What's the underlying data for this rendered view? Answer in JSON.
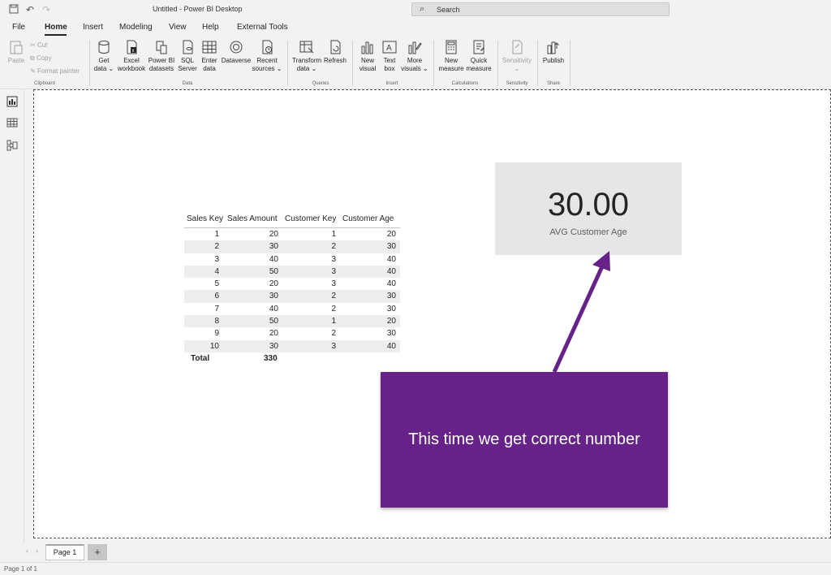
{
  "window": {
    "title": "Untitled - Power BI Desktop"
  },
  "search": {
    "label": "Search"
  },
  "menu": {
    "tabs": [
      "File",
      "Home",
      "Insert",
      "Modeling",
      "View",
      "Help",
      "External Tools"
    ],
    "active": "Home"
  },
  "ribbon": {
    "clipboard": {
      "paste": "Paste",
      "cut": "Cut",
      "copy": "Copy",
      "format_painter": "Format painter",
      "group": "Clipboard"
    },
    "data": {
      "get_data": [
        "Get",
        "data ⌄"
      ],
      "excel": [
        "Excel",
        "workbook"
      ],
      "powerbi": [
        "Power BI",
        "datasets"
      ],
      "sql": [
        "SQL",
        "Server"
      ],
      "enter": [
        "Enter",
        "data"
      ],
      "dataverse": [
        "Dataverse",
        ""
      ],
      "recent": [
        "Recent",
        "sources ⌄"
      ],
      "group": "Data"
    },
    "queries": {
      "transform": [
        "Transform",
        "data ⌄"
      ],
      "refresh": [
        "Refresh",
        ""
      ],
      "group": "Queries"
    },
    "insert": {
      "new_visual": [
        "New",
        "visual"
      ],
      "text_box": [
        "Text",
        "box"
      ],
      "more_visuals": [
        "More",
        "visuals ⌄"
      ],
      "group": "Insert"
    },
    "calculations": {
      "new_measure": [
        "New",
        "measure"
      ],
      "quick_measure": [
        "Quick",
        "measure"
      ],
      "group": "Calculations"
    },
    "sensitivity": {
      "label": [
        "Sensitivity",
        "⌄"
      ],
      "group": "Sensitivity"
    },
    "share": {
      "publish": [
        "Publish",
        ""
      ],
      "group": "Share"
    }
  },
  "table": {
    "columns": [
      "Sales Key",
      "Sales Amount",
      "Customer Key",
      "Customer Age"
    ],
    "rows": [
      [
        "1",
        "20",
        "1",
        "20"
      ],
      [
        "2",
        "30",
        "2",
        "30"
      ],
      [
        "3",
        "40",
        "3",
        "40"
      ],
      [
        "4",
        "50",
        "3",
        "40"
      ],
      [
        "5",
        "20",
        "3",
        "40"
      ],
      [
        "6",
        "30",
        "2",
        "30"
      ],
      [
        "7",
        "40",
        "2",
        "30"
      ],
      [
        "8",
        "50",
        "1",
        "20"
      ],
      [
        "9",
        "20",
        "2",
        "30"
      ],
      [
        "10",
        "30",
        "3",
        "40"
      ]
    ],
    "total_label": "Total",
    "total_value": "330"
  },
  "card": {
    "value": "30.00",
    "label": "AVG Customer Age"
  },
  "annotation": {
    "text": "This time we get correct number",
    "color": "#662288"
  },
  "pages": {
    "tab": "Page 1",
    "add": "+"
  },
  "status": {
    "text": "Page 1 of 1"
  }
}
